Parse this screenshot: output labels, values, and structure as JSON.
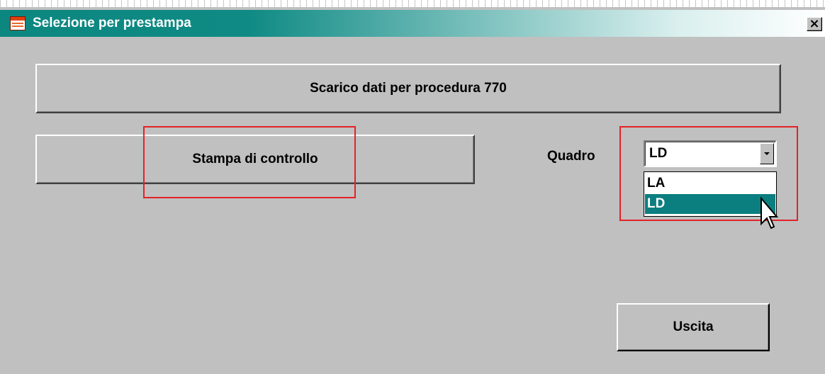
{
  "window": {
    "title": "Selezione per prestampa",
    "close_glyph": "×",
    "titlebar_colors": [
      "#0c8780",
      "#ffffff"
    ],
    "background": "#c0c0c0"
  },
  "buttons": {
    "scarico": "Scarico dati per procedura 770",
    "stampa": "Stampa di controllo",
    "uscita": "Uscita"
  },
  "quadro": {
    "label": "Quadro",
    "selected": "LD",
    "options": [
      "LA",
      "LD"
    ],
    "highlighted_option": "LD",
    "highlight_color": "#0b7e80"
  },
  "annotations": {
    "box_color": "#e32227"
  },
  "icons": [
    "window-icon",
    "close-icon",
    "dropdown-arrow-icon",
    "mouse-pointer-icon"
  ]
}
